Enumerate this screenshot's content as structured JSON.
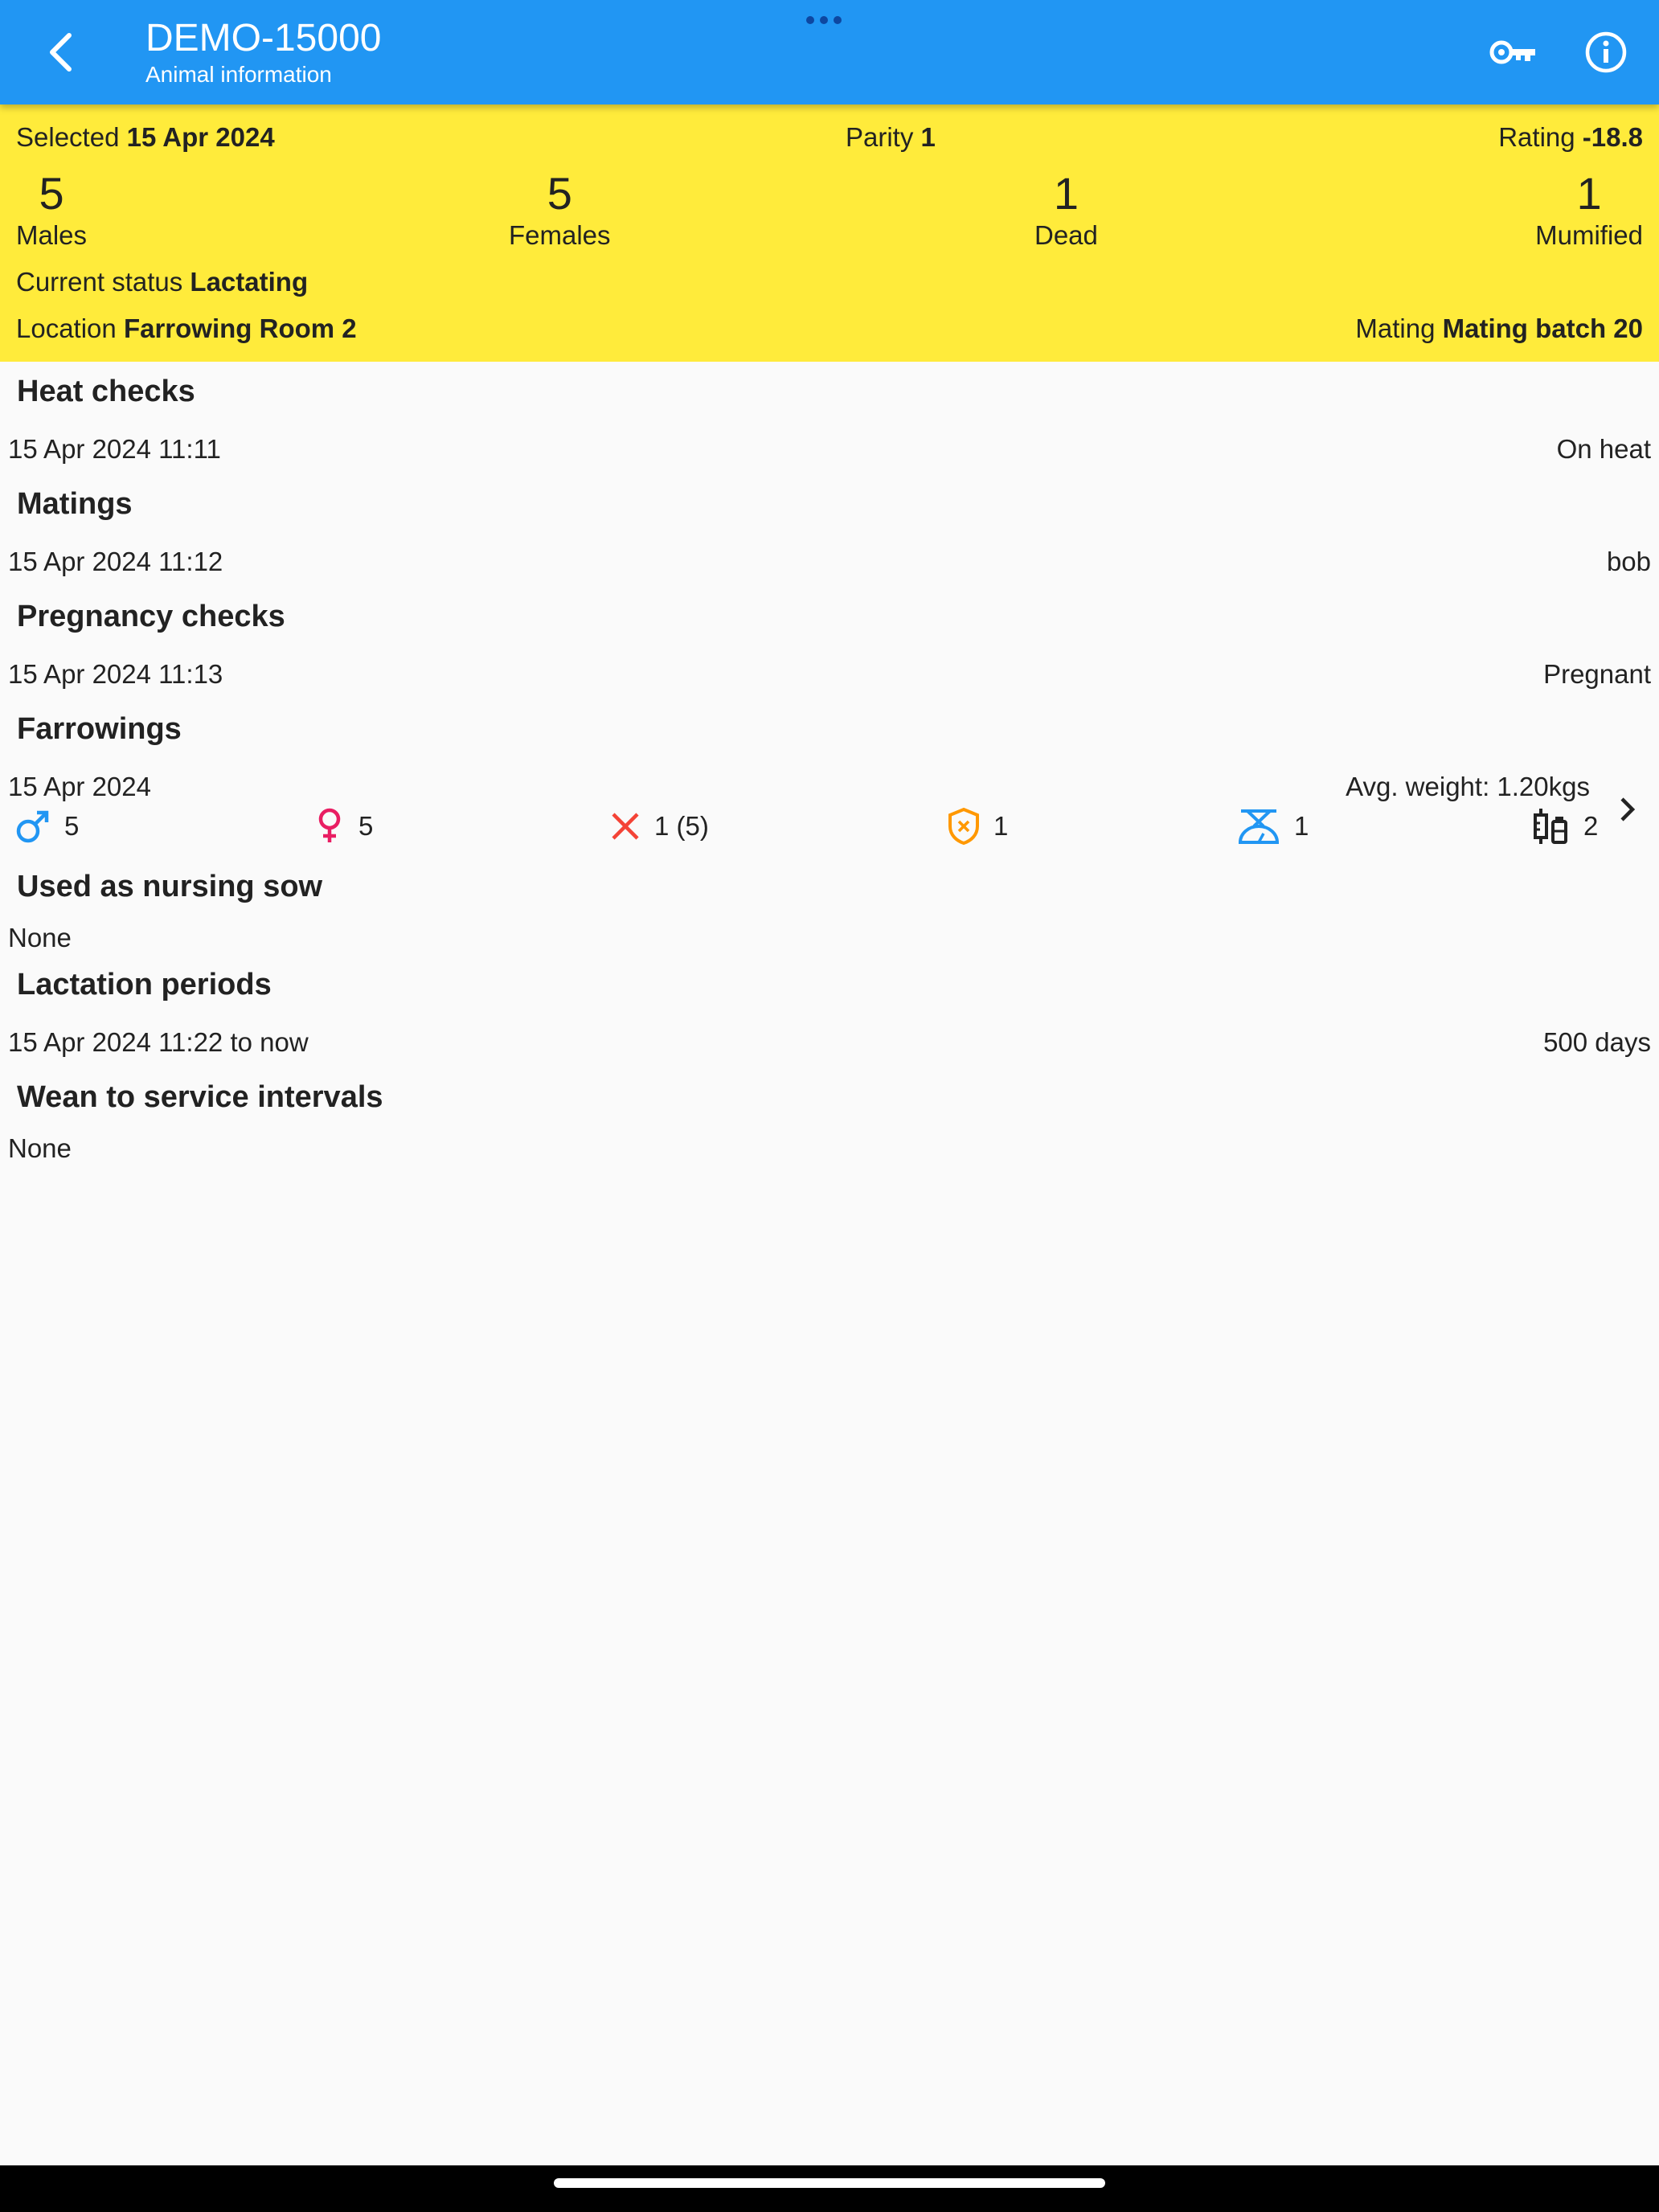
{
  "header": {
    "title": "DEMO-15000",
    "subtitle": "Animal information"
  },
  "summary": {
    "selected_label": "Selected",
    "selected_value": "15 Apr 2024",
    "parity_label": "Parity",
    "parity_value": "1",
    "rating_label": "Rating",
    "rating_value": "-18.8",
    "counts": [
      {
        "value": "5",
        "label": "Males"
      },
      {
        "value": "5",
        "label": "Females"
      },
      {
        "value": "1",
        "label": "Dead"
      },
      {
        "value": "1",
        "label": "Mumified"
      }
    ],
    "status_label": "Current status",
    "status_value": "Lactating",
    "location_label": "Location",
    "location_value": "Farrowing Room 2",
    "mating_label": "Mating",
    "mating_value": "Mating batch 20"
  },
  "sections": {
    "heat_checks": {
      "title": "Heat checks",
      "date": "15 Apr 2024 11:11",
      "value": "On heat"
    },
    "matings": {
      "title": "Matings",
      "date": "15 Apr 2024 11:12",
      "value": "bob"
    },
    "pregnancy_checks": {
      "title": "Pregnancy checks",
      "date": "15 Apr 2024 11:13",
      "value": "Pregnant"
    },
    "farrowings": {
      "title": "Farrowings",
      "date": "15 Apr 2024",
      "avg_weight": "Avg. weight: 1.20kgs",
      "males": "5",
      "females": "5",
      "dead": "1 (5)",
      "mumified": "1",
      "weighed": "1",
      "treatments": "2"
    },
    "nursing_sow": {
      "title": "Used as nursing sow",
      "value": "None"
    },
    "lactation": {
      "title": "Lactation periods",
      "date": "15 Apr 2024 11:22 to now",
      "value": "500 days"
    },
    "wean_to_service": {
      "title": "Wean to service intervals",
      "value": "None"
    }
  },
  "colors": {
    "appbar": "#2196f3",
    "summary_bg": "#ffeb3b",
    "male": "#2196f3",
    "female": "#e91e63",
    "dead": "#f44336",
    "mumified": "#ff9800"
  }
}
